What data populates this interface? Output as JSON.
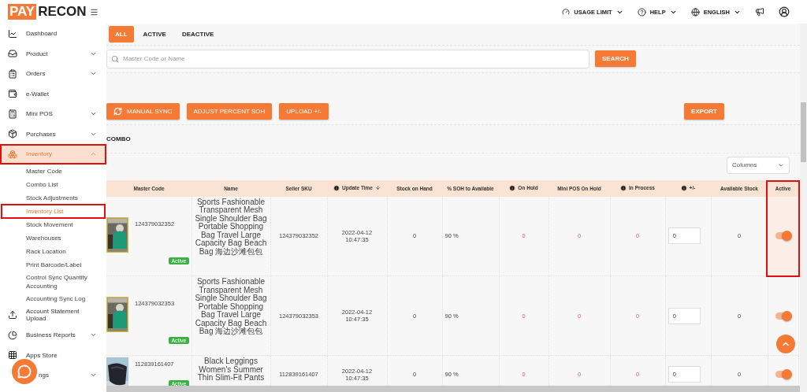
{
  "logo": {
    "left": "PAY",
    "right": "RECON"
  },
  "topbar": {
    "items": [
      {
        "label": "USAGE LIMIT"
      },
      {
        "label": "HELP"
      },
      {
        "label": "ENGLISH"
      }
    ]
  },
  "sidebar": {
    "items": [
      {
        "label": "Dashboard",
        "selected": false
      },
      {
        "label": "Product",
        "selected": false,
        "expanded": false
      },
      {
        "label": "Orders",
        "selected": false,
        "expanded": false
      },
      {
        "label": "e-Wallet",
        "selected": false
      },
      {
        "label": "Mini POS",
        "selected": false,
        "expanded": false
      },
      {
        "label": "Purchases",
        "selected": false,
        "expanded": false
      },
      {
        "label": "Inventory",
        "selected": true,
        "expanded": true,
        "annotated": true,
        "children": [
          {
            "label": "Master Code",
            "selected": false
          },
          {
            "label": "Combo List",
            "selected": false
          },
          {
            "label": "Stock Adjustments",
            "selected": false
          },
          {
            "label": "Inventory List",
            "selected": true,
            "annotated": true
          },
          {
            "label": "Stock Movement",
            "selected": false
          },
          {
            "label": "Warehouses",
            "selected": false
          },
          {
            "label": "Rack Location",
            "selected": false
          },
          {
            "label": "Print Barcode/Label",
            "selected": false
          },
          {
            "label": "Control Sync Quantity Accounting",
            "selected": false
          },
          {
            "label": "Accounting Sync Log",
            "selected": false
          }
        ]
      },
      {
        "label": "Account Statement Upload",
        "selected": false
      },
      {
        "label": "Business Reports",
        "selected": false,
        "expanded": false
      },
      {
        "label": "Apps Store",
        "selected": false
      },
      {
        "label": "ngs",
        "selected": false,
        "expanded": false
      }
    ]
  },
  "tabs": [
    {
      "label": "ALL",
      "selected": true
    },
    {
      "label": "ACTIVE",
      "selected": false
    },
    {
      "label": "DEACTIVE",
      "selected": false
    }
  ],
  "search": {
    "placeholder": "Master Code or Name",
    "button": "SEARCH"
  },
  "actions": [
    {
      "label": "MANUAL SYNC",
      "kind": "sync"
    },
    {
      "label": "ADJUST PERCENT SOH",
      "kind": "plain"
    },
    {
      "label": "UPLOAD +/-",
      "kind": "plain"
    }
  ],
  "export": "EXPORT",
  "section_title": "COMBO",
  "columns_select": "Columns",
  "table": {
    "columns": [
      {
        "label": "Master Code"
      },
      {
        "label": "Name"
      },
      {
        "label": "Seller SKU"
      },
      {
        "label": "Update Time",
        "info": true,
        "sorted_descending": true
      },
      {
        "label": "Stock on Hand"
      },
      {
        "label": "% SOH to Available"
      },
      {
        "label": "On Hold",
        "info": true
      },
      {
        "label": "Mini POS On Hold"
      },
      {
        "label": "In Process",
        "info": true
      },
      {
        "label": "+/-",
        "info": true
      },
      {
        "label": "Available Stock"
      },
      {
        "label": "Active",
        "annotated": true
      }
    ],
    "rows": [
      {
        "code": "124379032352",
        "status": "Active",
        "name": "Sports Fashionable Transparent Mesh Single Shoulder Bag Portable Shopping Bag Travel Large Capacity Bag Beach Bag 海边沙滩包包",
        "sku": "124379032352",
        "update_time": "2022-04-12 10:47:35",
        "stock_on_hand": "0",
        "soh_pct": "90 %",
        "on_hold": "0",
        "mini_pos_on_hold": "0",
        "in_process": "0",
        "adjust": "0",
        "available": "0",
        "active": true
      },
      {
        "code": "124379032353",
        "status": "Active",
        "name": "Sports Fashionable Transparent Mesh Single Shoulder Bag Portable Shopping Bag Travel Large Capacity Bag Beach Bag 海边沙滩包包",
        "sku": "124379032353",
        "update_time": "2022-04-12 10:47:35",
        "stock_on_hand": "0",
        "soh_pct": "90 %",
        "on_hold": "0",
        "mini_pos_on_hold": "0",
        "in_process": "0",
        "adjust": "0",
        "available": "0",
        "active": true
      },
      {
        "code": "112839161407",
        "status": "Active",
        "name": "Black Leggings Women's Summer Thin Slim-Fit Pants",
        "sku": "112839161407",
        "update_time": "2022-04-12 10:47:35",
        "stock_on_hand": "0",
        "soh_pct": "90 %",
        "on_hold": "0",
        "mini_pos_on_hold": "0",
        "in_process": "0",
        "adjust": "0",
        "available": "0",
        "active": true
      }
    ]
  }
}
